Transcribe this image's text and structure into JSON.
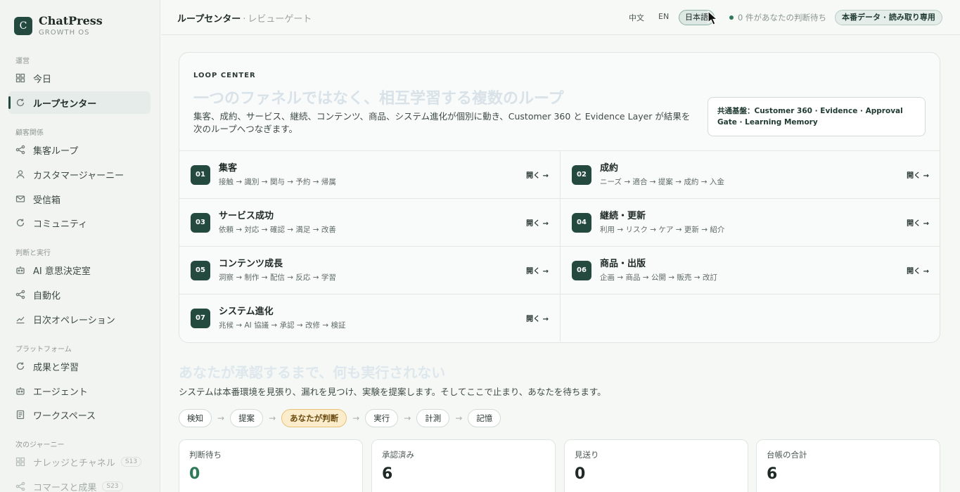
{
  "brand": {
    "logo_letter": "C",
    "name": "ChatPress",
    "subtitle": "GROWTH OS"
  },
  "sidebar": {
    "sections": [
      {
        "label": "運営"
      },
      {
        "label": "顧客関係"
      },
      {
        "label": "判断と実行"
      },
      {
        "label": "プラットフォーム"
      },
      {
        "label": "次のジャーニー"
      }
    ],
    "items": [
      {
        "label": "今日",
        "icon": "grid-icon"
      },
      {
        "label": "ループセンター",
        "icon": "refresh-icon",
        "active": true
      },
      {
        "label": "集客ループ",
        "icon": "share-icon"
      },
      {
        "label": "カスタマージャーニー",
        "icon": "user-icon"
      },
      {
        "label": "受信箱",
        "icon": "mail-icon"
      },
      {
        "label": "コミュニティ",
        "icon": "refresh-icon"
      },
      {
        "label": "AI 意思決定室",
        "icon": "robot-icon"
      },
      {
        "label": "自動化",
        "icon": "share-icon"
      },
      {
        "label": "日次オペレーション",
        "icon": "trend-icon"
      },
      {
        "label": "成果と学習",
        "icon": "refresh-icon"
      },
      {
        "label": "エージェント",
        "icon": "robot-icon"
      },
      {
        "label": "ワークスペース",
        "icon": "document-icon"
      },
      {
        "label": "ナレッジとチャネル",
        "icon": "grid-icon",
        "badge": "S13"
      },
      {
        "label": "コマースと成果",
        "icon": "share-icon",
        "badge": "S23"
      }
    ]
  },
  "topbar": {
    "title": "ループセンター",
    "separator": "·",
    "subtitle": "レビューゲート",
    "lang_zh": "中文",
    "lang_en": "EN",
    "lang_ja": "日本語",
    "pending": "0 件があなたの判断待ち",
    "readonly": "本番データ · 読み取り専用"
  },
  "loop_center": {
    "eyebrow": "LOOP CENTER",
    "title": "一つのファネルではなく、相互学習する複数のループ",
    "description": "集客、成約、サービス、継続、コンテンツ、商品、システム進化が個別に動き、Customer 360 と Evidence Layer が結果を次のループへつなぎます。",
    "foundation": "共通基盤：Customer 360 · Evidence · Approval Gate · Learning Memory",
    "open_label": "開く →",
    "loops": [
      {
        "num": "01",
        "title": "集客",
        "steps": "接触 → 識別 → 関与 → 予約 → 帰属"
      },
      {
        "num": "02",
        "title": "成約",
        "steps": "ニーズ → 適合 → 提案 → 成約 → 入金"
      },
      {
        "num": "03",
        "title": "サービス成功",
        "steps": "依頼 → 対応 → 確認 → 満足 → 改善"
      },
      {
        "num": "04",
        "title": "継続・更新",
        "steps": "利用 → リスク → ケア → 更新 → 紹介"
      },
      {
        "num": "05",
        "title": "コンテンツ成長",
        "steps": "洞察 → 制作 → 配信 → 反応 → 学習"
      },
      {
        "num": "06",
        "title": "商品・出版",
        "steps": "企画 → 商品 → 公開 → 販売 → 改訂"
      },
      {
        "num": "07",
        "title": "システム進化",
        "steps": "兆候 → AI 協議 → 承認 → 改修 → 検証"
      }
    ]
  },
  "approval": {
    "title": "あなたが承認するまで、何も実行されない",
    "description": "システムは本番環境を見張り、漏れを見つけ、実験を提案します。そしてここで止まり、あなたを待ちます。",
    "steps": [
      "検知",
      "提案",
      "あなたが判断",
      "実行",
      "計測",
      "記憶"
    ],
    "arrow": "→",
    "stats": [
      {
        "label": "判断待ち",
        "value": "0"
      },
      {
        "label": "承認済み",
        "value": "6"
      },
      {
        "label": "見送り",
        "value": "0"
      },
      {
        "label": "台帳の合計",
        "value": "6"
      }
    ]
  },
  "colors": {
    "accent": "#244a40",
    "highlight": "#fbeccb",
    "success": "#2e7a57"
  }
}
